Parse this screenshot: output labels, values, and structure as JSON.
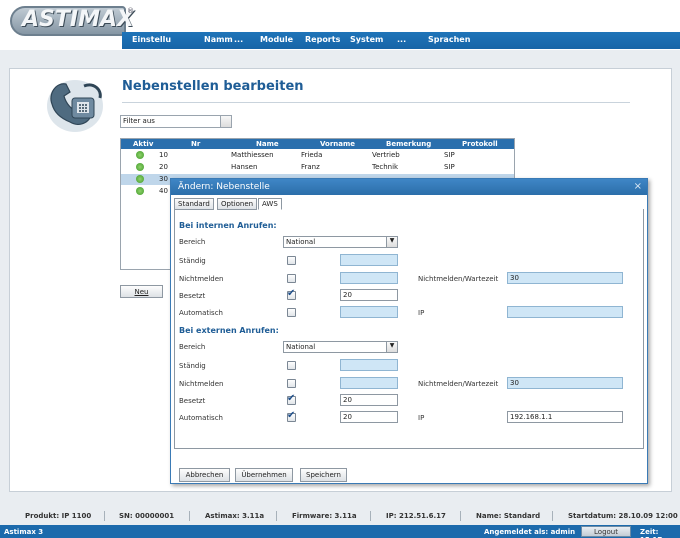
{
  "header": {
    "logo": "ASTIMAX",
    "nav": [
      "Einstellu",
      "Namm",
      "...",
      "Module",
      "Reports",
      "System",
      "...",
      "Sprachen"
    ]
  },
  "page": {
    "title": "Nebenstellen bearbeiten",
    "filter": "Filter aus",
    "new_button": "Neu",
    "columns": [
      "Aktiv",
      "Nr",
      "Name",
      "Vorname",
      "Bemerkung",
      "Protokoll"
    ],
    "rows": [
      {
        "nr": "10",
        "name": "Matthiessen",
        "vorname": "Frieda",
        "bemerkung": "Vertrieb",
        "protokoll": "SIP",
        "selected": false
      },
      {
        "nr": "20",
        "name": "Hansen",
        "vorname": "Franz",
        "bemerkung": "Technik",
        "protokoll": "SIP",
        "selected": false
      },
      {
        "nr": "30",
        "name": "",
        "vorname": "",
        "bemerkung": "",
        "protokoll": "",
        "selected": true
      },
      {
        "nr": "40",
        "name": "",
        "vorname": "",
        "bemerkung": "",
        "protokoll": "",
        "selected": false
      }
    ]
  },
  "dialog": {
    "title": "Ändern: Nebenstelle",
    "close": "×",
    "tabs": [
      "Standard",
      "Optionen",
      "AWS"
    ],
    "internal": {
      "heading": "Bei internen Anrufen:",
      "bereich_label": "Bereich",
      "bereich_value": "National",
      "staendig_label": "Ständig",
      "nichtmelden_label": "Nichtmelden",
      "besetzt_label": "Besetzt",
      "besetzt_value": "20",
      "automatisch_label": "Automatisch",
      "wartezeit_label": "Nichtmelden/Wartezeit",
      "wartezeit_value": "30",
      "ip_label": "IP",
      "ip_value": ""
    },
    "external": {
      "heading": "Bei externen Anrufen:",
      "bereich_label": "Bereich",
      "bereich_value": "National",
      "staendig_label": "Ständig",
      "nichtmelden_label": "Nichtmelden",
      "besetzt_label": "Besetzt",
      "besetzt_value": "20",
      "automatisch_label": "Automatisch",
      "automatisch_value": "20",
      "wartezeit_label": "Nichtmelden/Wartezeit",
      "wartezeit_value": "30",
      "ip_label": "IP",
      "ip_value": "192.168.1.1"
    },
    "buttons": [
      "Abbrechen",
      "Übernehmen",
      "Speichern"
    ]
  },
  "status": {
    "produkt": "Produkt: IP 1100",
    "sn": "SN: 00000001",
    "astimax": "Astimax: 3.11a",
    "firmware": "Firmware: 3.11a",
    "ip": "IP: 212.51.6.17",
    "name": "Name: Standard",
    "startdatum": "Startdatum: 28.10.09 12:00"
  },
  "bottom": {
    "app": "Astimax 3",
    "user": "Angemeldet als: admin",
    "logout": "Logout",
    "time": "Zeit: 15:17"
  },
  "colors": {
    "nav_blue": "#1f74b9",
    "dialog_blue": "#2b6ea9",
    "heading_blue": "#1f5d96",
    "field_blue": "#cfe6f6",
    "status_green": "#3f9a2a"
  }
}
